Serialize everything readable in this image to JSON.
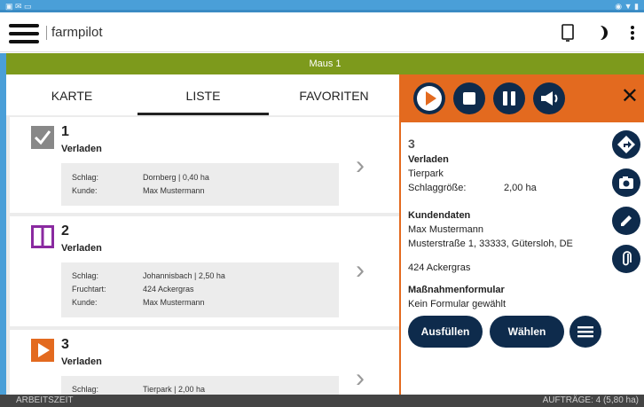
{
  "app": {
    "name": "farmpilot"
  },
  "header": {
    "machine": "Maus 1"
  },
  "tabs": [
    {
      "label": "KARTE"
    },
    {
      "label": "LISTE",
      "active": true
    },
    {
      "label": "FAVORITEN"
    }
  ],
  "list": [
    {
      "number": "1",
      "type": "Verladen",
      "status_icon": "check-icon",
      "fields": [
        {
          "key": "Schlag:",
          "value": "Dornberg  |  0,40 ha"
        },
        {
          "key": "Kunde:",
          "value": "Max Mustermann"
        }
      ]
    },
    {
      "number": "2",
      "type": "Verladen",
      "status_icon": "pause-icon",
      "fields": [
        {
          "key": "Schlag:",
          "value": "Johannisbach  |  2,50 ha"
        },
        {
          "key": "Fruchtart:",
          "value": "424 Ackergras"
        },
        {
          "key": "Kunde:",
          "value": "Max Mustermann"
        }
      ]
    },
    {
      "number": "3",
      "type": "Verladen",
      "status_icon": "play-icon",
      "fields": [
        {
          "key": "Schlag:",
          "value": "Tierpark  |  2,00 ha"
        }
      ]
    }
  ],
  "detail": {
    "number": "3",
    "type": "Verladen",
    "field_name": "Tierpark",
    "size_label": "Schlaggröße:",
    "size_value": "2,00 ha",
    "customer_heading": "Kundendaten",
    "customer_name": "Max Mustermann",
    "customer_address": "Musterstraße 1, 33333, Gütersloh, DE",
    "crop": "424 Ackergras",
    "form_heading": "Maßnahmenformular",
    "form_value": "Kein Formular gewählt",
    "fill_button": "Ausfüllen",
    "select_button": "Wählen"
  },
  "footer": {
    "left": "ARBEITSZEIT",
    "right": "AUFTRÄGE: 4 (5,80 ha)"
  },
  "colors": {
    "accent_orange": "#e36a1f",
    "navy": "#0e2b4c",
    "green": "#7d9a1c",
    "status_blue": "#4a9fd8"
  }
}
